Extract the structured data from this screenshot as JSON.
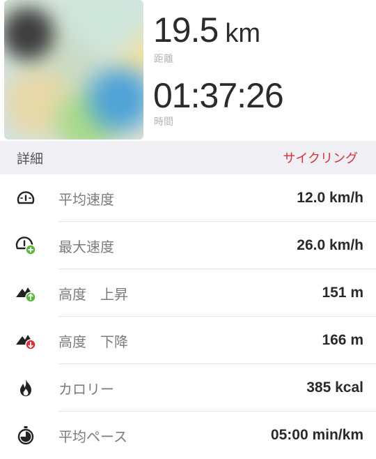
{
  "summary": {
    "distance": {
      "value": "19.5",
      "unit": "km",
      "label": "距離"
    },
    "time": {
      "value": "01:37:26",
      "label": "時間"
    }
  },
  "details": {
    "title": "詳細",
    "activity_type": "サイクリング"
  },
  "rows": [
    {
      "icon": "speedometer-icon",
      "label": "平均速度",
      "value": "12.0 km/h"
    },
    {
      "icon": "max-speedometer-icon",
      "label": "最大速度",
      "value": "26.0 km/h"
    },
    {
      "icon": "mountain-ascent-icon",
      "label": "高度　上昇",
      "value": "151 m"
    },
    {
      "icon": "mountain-descent-icon",
      "label": "高度　下降",
      "value": "166 m"
    },
    {
      "icon": "flame-icon",
      "label": "カロリー",
      "value": "385 kcal"
    },
    {
      "icon": "stopwatch-icon",
      "label": "平均ペース",
      "value": "05:00 min/km"
    }
  ],
  "colors": {
    "accent_red": "#d9303c",
    "ascent_green": "#5cb83c",
    "descent_red": "#d9303c",
    "header_bg": "#efeff4"
  }
}
